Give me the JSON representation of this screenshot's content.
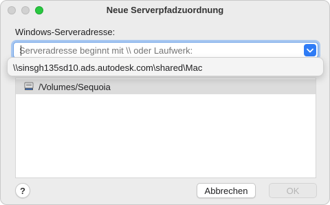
{
  "window": {
    "title": "Neue Serverpfadzuordnung"
  },
  "form": {
    "address_label": "Windows-Serveradresse:",
    "address_value": "",
    "address_placeholder": "Serveradresse beginnt mit \\\\ oder Laufwerk:"
  },
  "dropdown": {
    "items": [
      "\\\\sinsgh135sd10.ads.autodesk.com\\shared\\Mac"
    ]
  },
  "volumes": {
    "items": [
      {
        "label": "/Volumes/Sequoia",
        "icon": "drive-icon",
        "selected": true
      }
    ]
  },
  "buttons": {
    "help": "?",
    "cancel": "Abbrechen",
    "ok": "OK"
  },
  "colors": {
    "accent": "#2f7cf6",
    "focus_ring": "#a9c8f1",
    "zoom_green": "#28c840"
  }
}
